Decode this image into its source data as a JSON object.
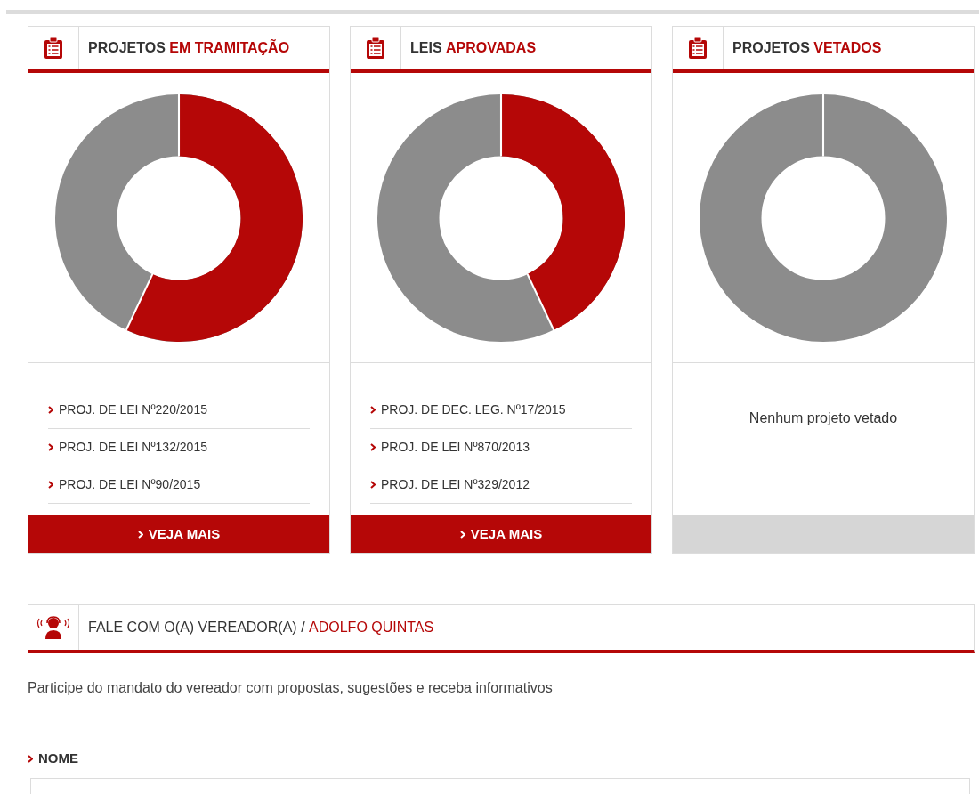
{
  "cards": [
    {
      "title": "PROJETOS",
      "title_highlight": "EM TRAMITAÇÃO",
      "items": [
        "PROJ. DE LEI Nº220/2015",
        "PROJ. DE LEI Nº132/2015",
        "PROJ. DE LEI Nº90/2015"
      ],
      "more_button": "VEJA MAIS"
    },
    {
      "title": "LEIS",
      "title_highlight": "APROVADAS",
      "items": [
        "PROJ. DE DEC. LEG. Nº17/2015",
        "PROJ. DE LEI Nº870/2013",
        "PROJ. DE LEI Nº329/2012"
      ],
      "more_button": "VEJA MAIS"
    },
    {
      "title": "PROJETOS",
      "title_highlight": "VETADOS",
      "empty_message": "Nenhum projeto vetado"
    }
  ],
  "contact": {
    "title": "FALE COM O(A) VEREADOR(A) /",
    "title_highlight": "ADOLFO QUINTAS",
    "description": "Participe do mandato do vereador com propostas, sugestões e receba informativos",
    "fields": [
      {
        "label": "NOME"
      }
    ]
  }
}
